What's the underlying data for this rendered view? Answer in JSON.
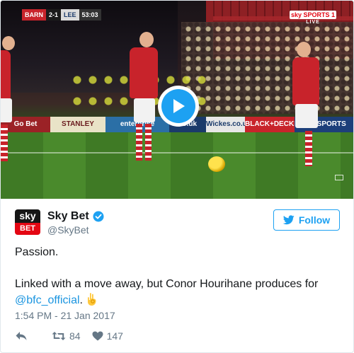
{
  "video": {
    "scorebug": {
      "home": "BARN",
      "score": "2-1",
      "away": "LEE",
      "time": "53:03"
    },
    "channel_logo": {
      "brand": "sky SPORTS 1",
      "live": "LIVE"
    },
    "boards": [
      "Go Bet",
      "STANLEY",
      "enterprise",
      "co.uk",
      "Wickes.co.uk",
      "BLACK+DECKER",
      "sky SPORTS"
    ],
    "play_icon": "play-icon"
  },
  "author": {
    "display_name": "Sky Bet",
    "handle": "@SkyBet",
    "verified": true,
    "avatar_top": "sky",
    "avatar_bottom": "BET"
  },
  "follow_button": {
    "label": "Follow",
    "icon": "twitter-bird-icon"
  },
  "tweet": {
    "line1": "Passion.",
    "line2": "Linked with a move away, but Conor Hourihane produces for",
    "mention": "@bfc_official",
    "after_mention": ".",
    "emoji": "ok-hand-emoji"
  },
  "timestamp": "1:54 PM - 21 Jan 2017",
  "actions": {
    "reply_icon": "reply-icon",
    "retweet_count": "84",
    "like_count": "147"
  },
  "colors": {
    "twitter_blue": "#1da1f2",
    "link_blue": "#1b95e0",
    "muted_text": "#657786",
    "sky_red": "#e40613"
  }
}
